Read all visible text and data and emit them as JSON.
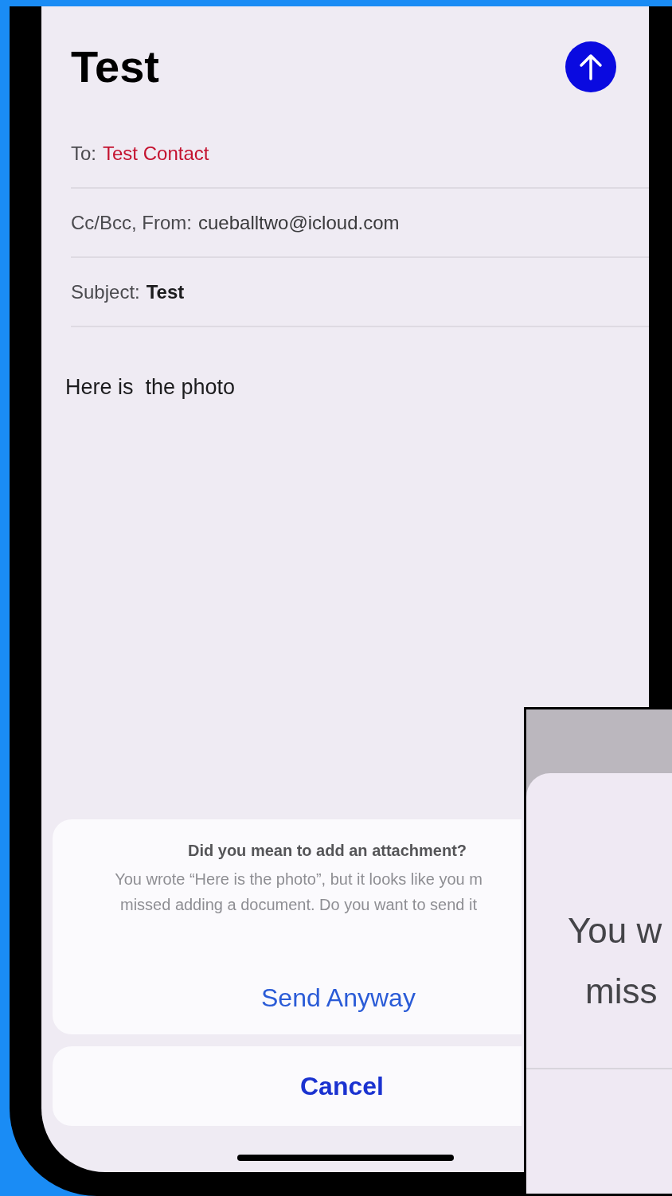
{
  "compose": {
    "title": "Test",
    "fields": [
      {
        "label": "To:",
        "value": "Test Contact",
        "kind": "recipient"
      },
      {
        "label": "Cc/Bcc, From:",
        "value": "cueballtwo@icloud.com",
        "kind": "plain"
      },
      {
        "label": "Subject:",
        "value": "Test",
        "kind": "subject"
      }
    ],
    "body": "Here is  the photo"
  },
  "alert": {
    "title": "Did you mean to add an attachment?",
    "message_lines": [
      "You wrote “Here is the photo”, but it looks like you m",
      "missed adding a document. Do you want to send it"
    ],
    "actions": [
      {
        "label": "Send Anyway",
        "kind": "default"
      },
      {
        "label": "Cancel",
        "kind": "cancel"
      }
    ]
  },
  "zoom_inset": {
    "lines": [
      "You w",
      "miss"
    ]
  }
}
